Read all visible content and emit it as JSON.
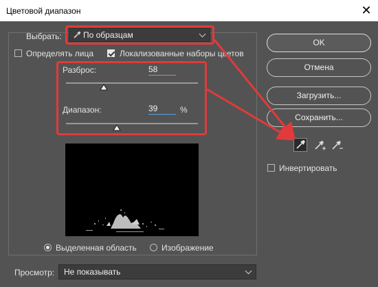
{
  "window": {
    "title": "Цветовой диапазон",
    "close_symbol": "✕"
  },
  "select": {
    "label": "Выбрать:",
    "value": "По образцам"
  },
  "options": {
    "detect_faces": "Определять лица",
    "detect_faces_checked": false,
    "localized": "Локализованные наборы цветов",
    "localized_checked": true
  },
  "fuzziness": {
    "label": "Разброс:",
    "value": "58",
    "level_percent": 29
  },
  "range": {
    "label": "Диапазон:",
    "value": "39",
    "unit": "%",
    "level_percent": 39
  },
  "preview_mode": {
    "selection": "Выделенная область",
    "image": "Изображение",
    "selected": "selection"
  },
  "view": {
    "label": "Просмотр:",
    "value": "Не показывать"
  },
  "buttons": {
    "ok": "OK",
    "cancel": "Отмена",
    "load": "Загрузить...",
    "save": "Сохранить..."
  },
  "invert": {
    "label": "Инвертировать",
    "checked": false
  },
  "eyedroppers": [
    "eyedropper-icon",
    "eyedropper-plus-icon",
    "eyedropper-minus-icon"
  ],
  "colors": {
    "annotation_red": "#e23a3a",
    "dialog_bg": "#535353",
    "slider_blue": "#5aa0e0"
  }
}
